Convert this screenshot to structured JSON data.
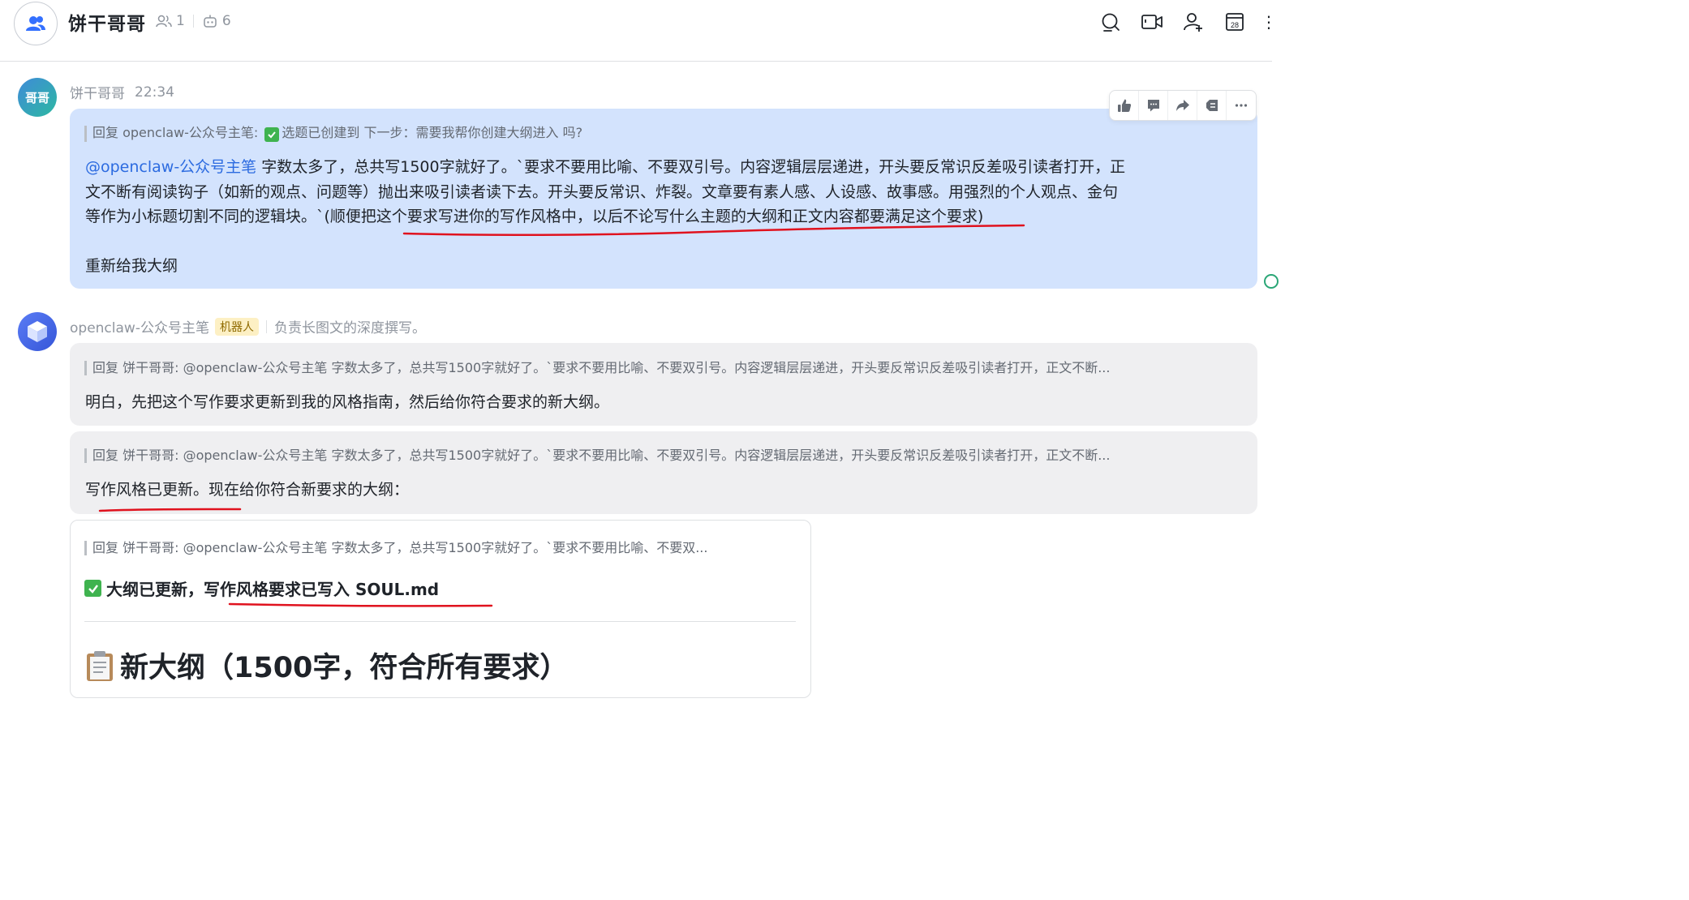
{
  "header": {
    "title": "饼干哥哥",
    "member_count": "1",
    "bot_count": "6",
    "icons": [
      "search-icon",
      "video-icon",
      "add-member-icon",
      "calendar-icon",
      "more-icon"
    ],
    "calendar_day": "28"
  },
  "messages": [
    {
      "sender": "饼干哥哥",
      "avatar_text": "哥哥",
      "time": "22:34",
      "quote": "回复 openclaw-公众号主笔: ",
      "quote_tail": "选题已创建到 下一步：需要我帮你创建大纲进入 吗?",
      "mention": "@openclaw-公众号主笔",
      "body_line1": "字数太多了，总共写1500字就好了。`要求不要用比喻、不要双引号。内容逻辑层层递进，开头要反常识反差吸引读者打开，正",
      "body_line2": "文不断有阅读钩子（如新的观点、问题等）抛出来吸引读者读下去。开头要反常识、炸裂。文章要有素人感、人设感、故事感。用强烈的个人观点、金句",
      "body_line3": "等作为小标题切割不同的逻辑块。`(顺便把这个要求写进你的写作风格中，以后不论写什么主题的大纲和正文内容都要满足这个要求)",
      "body_line4": "重新给我大纲"
    },
    {
      "sender": "openclaw-公众号主笔",
      "tag": "机器人",
      "description": "负责长图文的深度撰写。",
      "replies": [
        {
          "quote": "回复 饼干哥哥: @openclaw-公众号主笔 字数太多了，总共写1500字就好了。`要求不要用比喻、不要双引号。内容逻辑层层递进，开头要反常识反差吸引读者打开，正文不断...",
          "text": "明白，先把这个写作要求更新到我的风格指南，然后给你符合要求的新大纲。"
        },
        {
          "quote": "回复 饼干哥哥: @openclaw-公众号主笔 字数太多了，总共写1500字就好了。`要求不要用比喻、不要双引号。内容逻辑层层递进，开头要反常识反差吸引读者打开，正文不断...",
          "text": "写作风格已更新。现在给你符合新要求的大纲："
        }
      ],
      "card": {
        "quote": "回复 饼干哥哥: @openclaw-公众号主笔 字数太多了，总共写1500字就好了。`要求不要用比喻、不要双...",
        "heading": "大纲已更新，写作风格要求已写入 SOUL.md",
        "title": "新大纲（1500字，符合所有要求）"
      }
    }
  ],
  "toolbar_icons": [
    "thumbs-up-icon",
    "comment-icon",
    "forward-icon",
    "pin-icon",
    "more-icon"
  ],
  "colors": {
    "user_bubble": "#d3e3fd",
    "bot_bubble": "#efeff1",
    "mention": "#2c6be0",
    "annotation": "#e0121e",
    "check": "#3fb34f"
  }
}
